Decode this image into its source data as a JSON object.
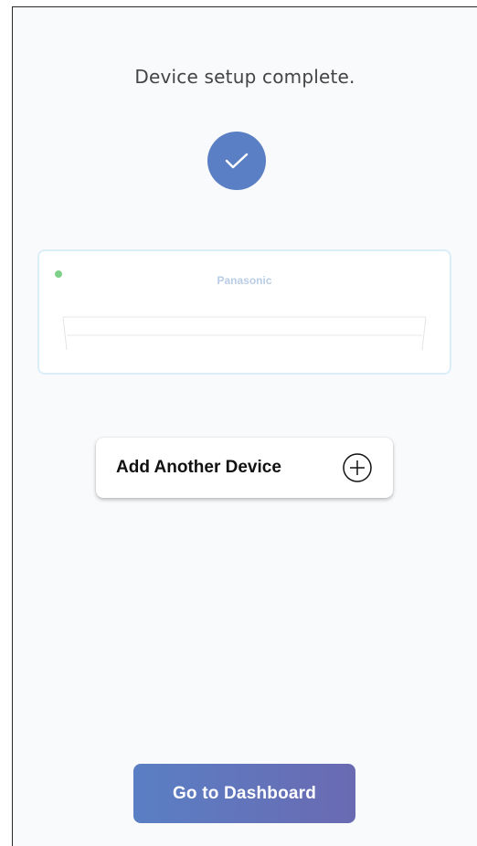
{
  "screen": {
    "title": "Device setup complete."
  },
  "device_card": {
    "brand": "Panasonic",
    "indicator_status": "on",
    "indicator_color": "#7fd08a"
  },
  "actions": {
    "add_device_label": "Add Another Device",
    "add_device_icon": "plus-circle-icon",
    "dashboard_label": "Go to Dashboard"
  },
  "colors": {
    "accent": "#5a7fc4",
    "accent_end": "#6a6ab2",
    "background": "#f9fafc"
  },
  "icons": {
    "success": "checkmark-icon"
  }
}
